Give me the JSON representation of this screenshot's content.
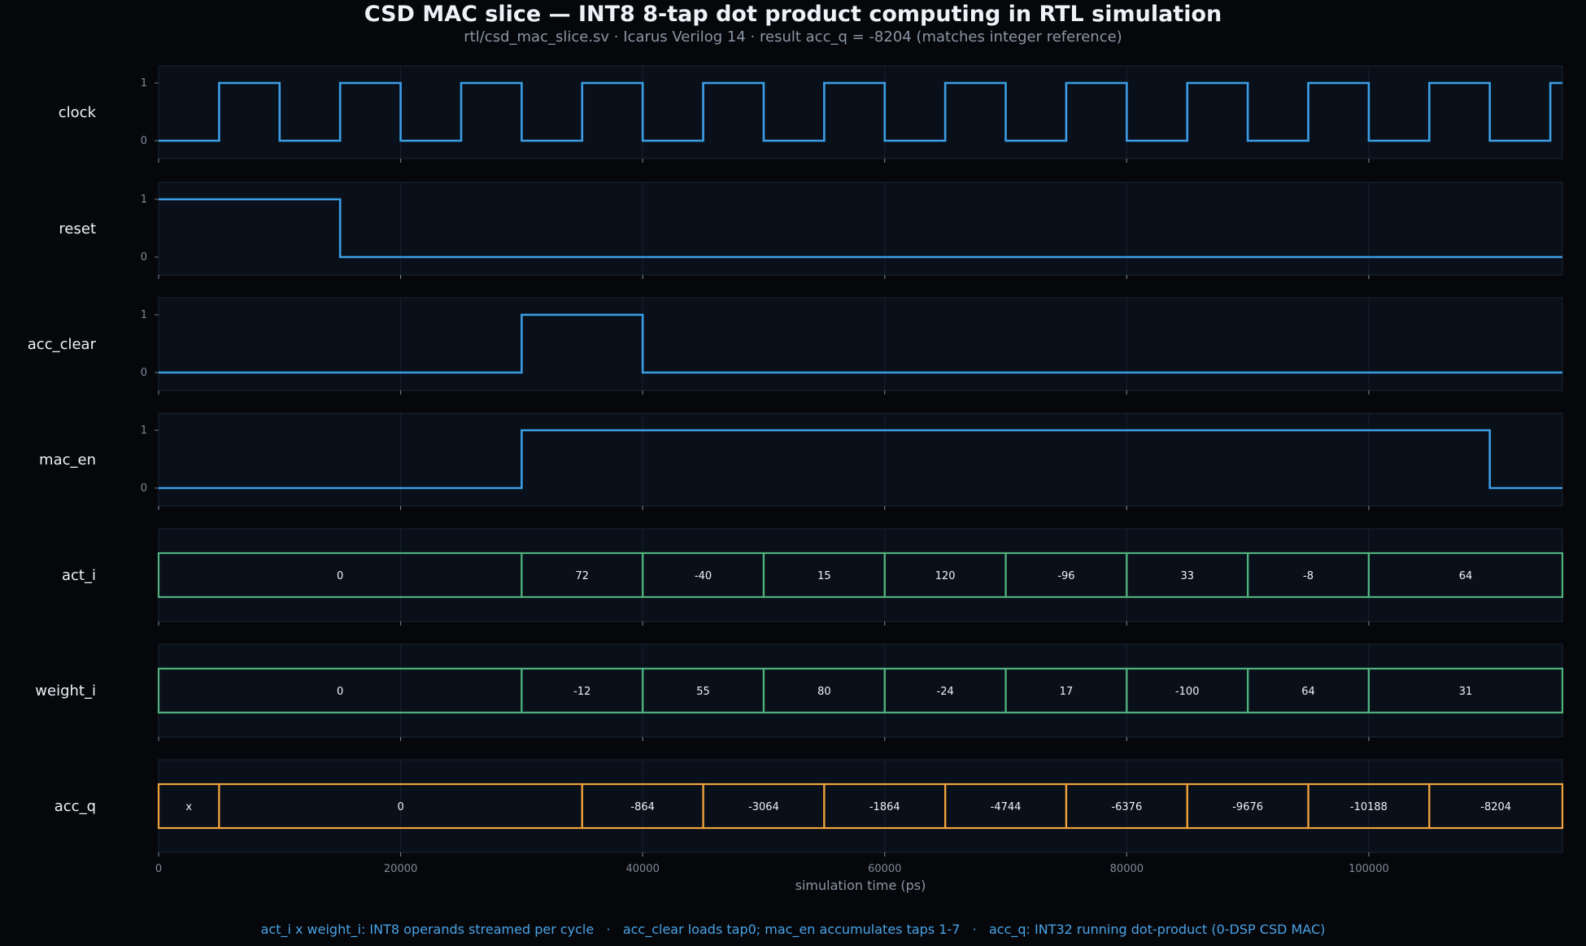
{
  "header": {
    "title": "CSD MAC slice — INT8 8-tap dot product computing in RTL simulation",
    "subtitle": "rtl/csd_mac_slice.sv · Icarus Verilog 14 · result acc_q = -8204 (matches integer reference)"
  },
  "footer": {
    "note": "act_i x weight_i: INT8 operands streamed per cycle   ·   acc_clear loads tap0; mac_en accumulates taps 1-7   ·   acc_q: INT32 running dot-product (0-DSP CSD MAC)"
  },
  "colors": {
    "background": "#05070b",
    "panel": "#0a101a",
    "digital": "#3b9ee6",
    "bus_operand": "#4fb27d",
    "bus_acc": "#f0a33a"
  },
  "chart_data": {
    "type": "waveform",
    "xlabel": "simulation time (ps)",
    "xlim": [
      0,
      116000
    ],
    "xticks": [
      0,
      20000,
      40000,
      60000,
      80000,
      100000
    ],
    "grid": true,
    "signals": [
      {
        "name": "clock",
        "kind": "digital",
        "ylim": [
          0,
          1
        ],
        "yticks": [
          0,
          1
        ],
        "initial": 0,
        "transitions": [
          [
            5000,
            1
          ],
          [
            10000,
            0
          ],
          [
            15000,
            1
          ],
          [
            20000,
            0
          ],
          [
            25000,
            1
          ],
          [
            30000,
            0
          ],
          [
            35000,
            1
          ],
          [
            40000,
            0
          ],
          [
            45000,
            1
          ],
          [
            50000,
            0
          ],
          [
            55000,
            1
          ],
          [
            60000,
            0
          ],
          [
            65000,
            1
          ],
          [
            70000,
            0
          ],
          [
            75000,
            1
          ],
          [
            80000,
            0
          ],
          [
            85000,
            1
          ],
          [
            90000,
            0
          ],
          [
            95000,
            1
          ],
          [
            100000,
            0
          ],
          [
            105000,
            1
          ],
          [
            110000,
            0
          ],
          [
            115000,
            1
          ]
        ]
      },
      {
        "name": "reset",
        "kind": "digital",
        "ylim": [
          0,
          1
        ],
        "yticks": [
          0,
          1
        ],
        "initial": 1,
        "transitions": [
          [
            15000,
            0
          ]
        ]
      },
      {
        "name": "acc_clear",
        "kind": "digital",
        "ylim": [
          0,
          1
        ],
        "yticks": [
          0,
          1
        ],
        "initial": 0,
        "transitions": [
          [
            30000,
            1
          ],
          [
            40000,
            0
          ]
        ]
      },
      {
        "name": "mac_en",
        "kind": "digital",
        "ylim": [
          0,
          1
        ],
        "yticks": [
          0,
          1
        ],
        "initial": 0,
        "transitions": [
          [
            30000,
            1
          ],
          [
            110000,
            0
          ]
        ]
      },
      {
        "name": "act_i",
        "kind": "bus",
        "color_key": "bus_operand",
        "segments": [
          {
            "start": 0,
            "end": 30000,
            "value": "0"
          },
          {
            "start": 30000,
            "end": 40000,
            "value": "72"
          },
          {
            "start": 40000,
            "end": 50000,
            "value": "-40"
          },
          {
            "start": 50000,
            "end": 60000,
            "value": "15"
          },
          {
            "start": 60000,
            "end": 70000,
            "value": "120"
          },
          {
            "start": 70000,
            "end": 80000,
            "value": "-96"
          },
          {
            "start": 80000,
            "end": 90000,
            "value": "33"
          },
          {
            "start": 90000,
            "end": 100000,
            "value": "-8"
          },
          {
            "start": 100000,
            "end": 116000,
            "value": "64"
          }
        ]
      },
      {
        "name": "weight_i",
        "kind": "bus",
        "color_key": "bus_operand",
        "segments": [
          {
            "start": 0,
            "end": 30000,
            "value": "0"
          },
          {
            "start": 30000,
            "end": 40000,
            "value": "-12"
          },
          {
            "start": 40000,
            "end": 50000,
            "value": "55"
          },
          {
            "start": 50000,
            "end": 60000,
            "value": "80"
          },
          {
            "start": 60000,
            "end": 70000,
            "value": "-24"
          },
          {
            "start": 70000,
            "end": 80000,
            "value": "17"
          },
          {
            "start": 80000,
            "end": 90000,
            "value": "-100"
          },
          {
            "start": 90000,
            "end": 100000,
            "value": "64"
          },
          {
            "start": 100000,
            "end": 116000,
            "value": "31"
          }
        ]
      },
      {
        "name": "acc_q",
        "kind": "bus",
        "color_key": "bus_acc",
        "segments": [
          {
            "start": 0,
            "end": 5000,
            "value": "x"
          },
          {
            "start": 5000,
            "end": 35000,
            "value": "0"
          },
          {
            "start": 35000,
            "end": 45000,
            "value": "-864"
          },
          {
            "start": 45000,
            "end": 55000,
            "value": "-3064"
          },
          {
            "start": 55000,
            "end": 65000,
            "value": "-1864"
          },
          {
            "start": 65000,
            "end": 75000,
            "value": "-4744"
          },
          {
            "start": 75000,
            "end": 85000,
            "value": "-6376"
          },
          {
            "start": 85000,
            "end": 95000,
            "value": "-9676"
          },
          {
            "start": 95000,
            "end": 105000,
            "value": "-10188"
          },
          {
            "start": 105000,
            "end": 116000,
            "value": "-8204"
          }
        ]
      }
    ]
  }
}
